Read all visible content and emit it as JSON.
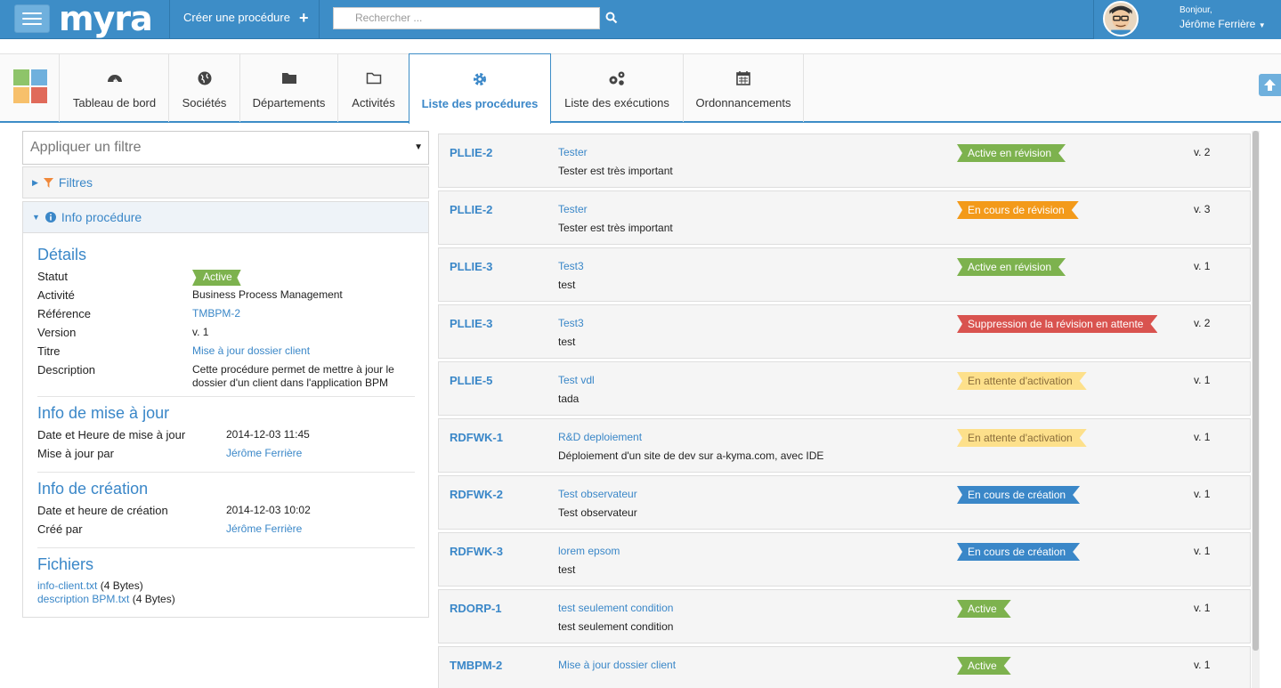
{
  "header": {
    "logo": "myra",
    "create_label": "Créer une procédure",
    "search_placeholder": "Rechercher ...",
    "greeting": "Bonjour,",
    "user_name": "Jérôme Ferrière"
  },
  "nav": {
    "tabs": [
      {
        "label": "Tableau de bord",
        "icon": "dashboard-icon"
      },
      {
        "label": "Sociétés",
        "icon": "globe-icon"
      },
      {
        "label": "Départements",
        "icon": "folder-icon"
      },
      {
        "label": "Activités",
        "icon": "folder-open-icon"
      },
      {
        "label": "Liste des procédures",
        "icon": "gear-icon",
        "active": true
      },
      {
        "label": "Liste des exécutions",
        "icon": "gears-icon"
      },
      {
        "label": "Ordonnancements",
        "icon": "calendar-icon"
      }
    ]
  },
  "left": {
    "filter_placeholder": "Appliquer un filtre",
    "filters_label": "Filtres",
    "info_label": "Info procédure",
    "details_title": "Détails",
    "details": {
      "statut_k": "Statut",
      "statut_v": "Active",
      "activite_k": "Activité",
      "activite_v": "Business Process Management",
      "reference_k": "Référence",
      "reference_v": "TMBPM-2",
      "version_k": "Version",
      "version_v": "v. 1",
      "titre_k": "Titre",
      "titre_v": "Mise à jour dossier client",
      "description_k": "Description",
      "description_v": "Cette procédure permet de mettre à jour le dossier d'un client dans l'application BPM"
    },
    "update_title": "Info de mise à jour",
    "update": {
      "date_k": "Date et Heure de mise à jour",
      "date_v": "2014-12-03 11:45",
      "by_k": "Mise à jour par",
      "by_v": "Jérôme Ferrière"
    },
    "creation_title": "Info de création",
    "creation": {
      "date_k": "Date et heure de création",
      "date_v": "2014-12-03 10:02",
      "by_k": "Créé par",
      "by_v": "Jérôme Ferrière"
    },
    "files_title": "Fichiers",
    "files": [
      {
        "name": "info-client.txt",
        "size": "(4 Bytes)"
      },
      {
        "name": "description BPM.txt",
        "size": "(4 Bytes)"
      }
    ]
  },
  "procedures": [
    {
      "ref": "PLLIE-2",
      "title": "Tester",
      "desc": "Tester est très important",
      "status": "Active en révision",
      "status_color": "#7db24e",
      "status_text": "#ffffff",
      "version": "v. 2"
    },
    {
      "ref": "PLLIE-2",
      "title": "Tester",
      "desc": "Tester est très important",
      "status": "En cours de révision",
      "status_color": "#f39a1a",
      "status_text": "#ffffff",
      "version": "v. 3"
    },
    {
      "ref": "PLLIE-3",
      "title": "Test3",
      "desc": "test",
      "status": "Active en révision",
      "status_color": "#7db24e",
      "status_text": "#ffffff",
      "version": "v. 1"
    },
    {
      "ref": "PLLIE-3",
      "title": "Test3",
      "desc": "test",
      "status": "Suppression de la révision en attente",
      "status_color": "#d9534f",
      "status_text": "#ffffff",
      "version": "v. 2"
    },
    {
      "ref": "PLLIE-5",
      "title": "Test vdl",
      "desc": "tada",
      "status": "En attente d'activation",
      "status_color": "#fde08b",
      "status_text": "#8a6d3b",
      "version": "v. 1"
    },
    {
      "ref": "RDFWK-1",
      "title": "R&D deploiement",
      "desc": "Déploiement d'un site de dev sur a-kyma.com, avec IDE",
      "status": "En attente d'activation",
      "status_color": "#fde08b",
      "status_text": "#8a6d3b",
      "version": "v. 1"
    },
    {
      "ref": "RDFWK-2",
      "title": "Test observateur",
      "desc": "Test observateur",
      "status": "En cours de création",
      "status_color": "#3a87c8",
      "status_text": "#ffffff",
      "version": "v. 1"
    },
    {
      "ref": "RDFWK-3",
      "title": "lorem epsom",
      "desc": "test",
      "status": "En cours de création",
      "status_color": "#3a87c8",
      "status_text": "#ffffff",
      "version": "v. 1"
    },
    {
      "ref": "RDORP-1",
      "title": "test seulement condition",
      "desc": "test seulement condition",
      "status": "Active",
      "status_color": "#7db24e",
      "status_text": "#ffffff",
      "version": "v. 1"
    },
    {
      "ref": "TMBPM-2",
      "title": "Mise à jour dossier client",
      "desc": "",
      "status": "Active",
      "status_color": "#7db24e",
      "status_text": "#ffffff",
      "version": "v. 1"
    }
  ]
}
